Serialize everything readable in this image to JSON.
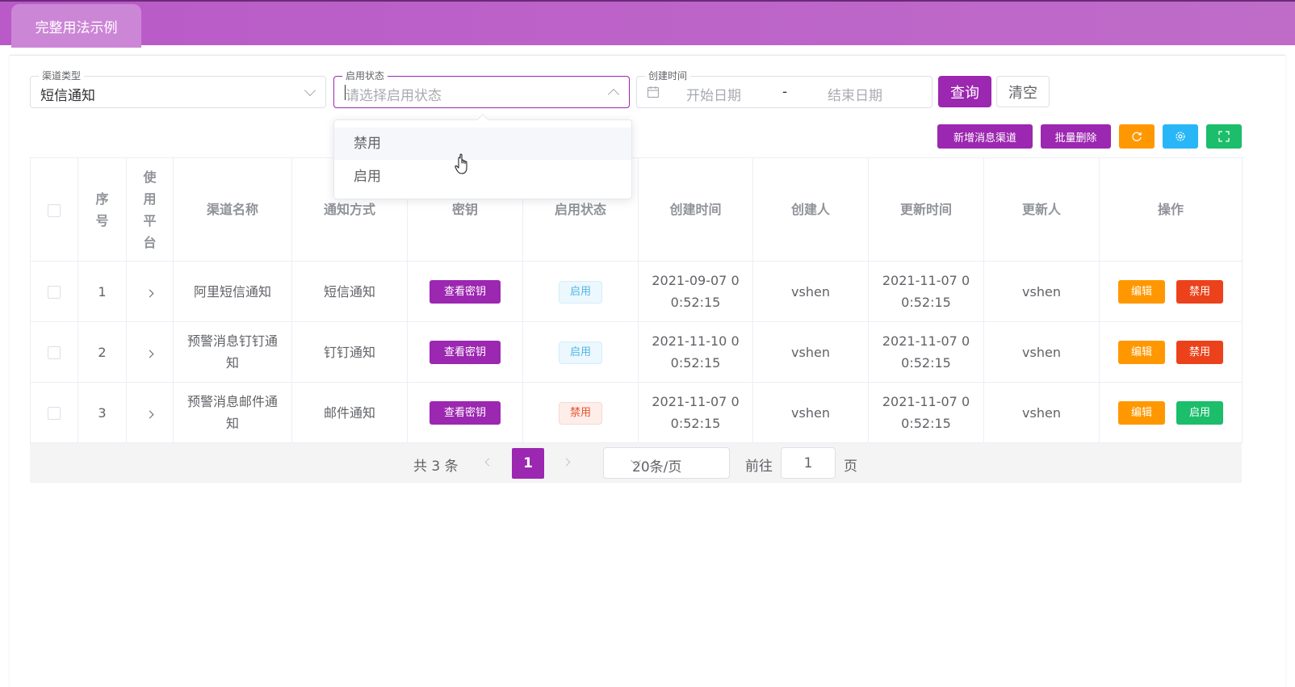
{
  "header": {
    "tab_label": "完整用法示例"
  },
  "filters": {
    "channel_type": {
      "label": "渠道类型",
      "value": "短信通知"
    },
    "status": {
      "label": "启用状态",
      "placeholder": "请选择启用状态"
    },
    "created_time": {
      "label": "创建时间",
      "start_placeholder": "开始日期",
      "separator": "-",
      "end_placeholder": "结束日期"
    },
    "query_label": "查询",
    "clear_label": "清空"
  },
  "dropdown": {
    "options": [
      "禁用",
      "启用"
    ],
    "hovered": "禁用"
  },
  "toolbar": {
    "add_label": "新增消息渠道",
    "batch_delete_label": "批量删除",
    "refresh_icon": "refresh-icon",
    "settings_icon": "gear-icon",
    "fullscreen_icon": "fullscreen-icon",
    "colors": {
      "primary": "#9c27b0",
      "warning": "#ff9800",
      "info": "#29b6f6",
      "success": "#1cbd6b",
      "danger": "#ec421c"
    }
  },
  "table": {
    "columns": [
      "序号",
      "使用平台",
      "渠道名称",
      "通知方式",
      "密钥",
      "启用状态",
      "创建时间",
      "创建人",
      "更新时间",
      "更新人",
      "操作"
    ],
    "rows": [
      {
        "index": "1",
        "name": "阿里短信通知",
        "method": "短信通知",
        "key_btn": "查看密钥",
        "status": "启用",
        "created": "2021-09-07 00:52:15",
        "creator": "vshen",
        "updated": "2021-11-07 00:52:15",
        "updater": "vshen",
        "edit": "编辑",
        "toggle": "禁用"
      },
      {
        "index": "2",
        "name": "预警消息钉钉通知",
        "method": "钉钉通知",
        "key_btn": "查看密钥",
        "status": "启用",
        "created": "2021-11-10 00:52:15",
        "creator": "vshen",
        "updated": "2021-11-07 00:52:15",
        "updater": "vshen",
        "edit": "编辑",
        "toggle": "禁用"
      },
      {
        "index": "3",
        "name": "预警消息邮件通知",
        "method": "邮件通知",
        "key_btn": "查看密钥",
        "status": "禁用",
        "created": "2021-11-07 00:52:15",
        "creator": "vshen",
        "updated": "2021-11-07 00:52:15",
        "updater": "vshen",
        "edit": "编辑",
        "toggle": "启用"
      }
    ]
  },
  "pagination": {
    "total_label": "共 3 条",
    "current_page": "1",
    "page_size": "20条/页",
    "goto_label": "前往",
    "goto_value": "1",
    "page_unit": "页"
  }
}
